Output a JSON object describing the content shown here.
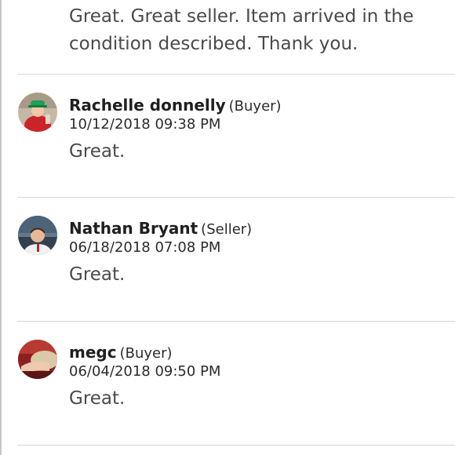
{
  "top_review": {
    "text": "Great. Great seller. Item arrived in the condition described. Thank you."
  },
  "reviews": [
    {
      "name": "Rachelle donnelly",
      "role": "(Buyer)",
      "date": "10/12/2018 09:38 PM",
      "comment": "Great.",
      "avatar_icon": "user-avatar-red-shirt-green-hat"
    },
    {
      "name": "Nathan Bryant",
      "role": "(Seller)",
      "date": "06/18/2018 07:08 PM",
      "comment": "Great.",
      "avatar_icon": "user-avatar-young-man"
    },
    {
      "name": "megc",
      "role": "(Buyer)",
      "date": "06/04/2018 09:50 PM",
      "comment": "Great.",
      "avatar_icon": "user-avatar-arm-red"
    }
  ]
}
